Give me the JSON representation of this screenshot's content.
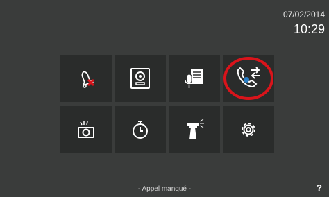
{
  "status": {
    "date": "07/02/2014",
    "time": "10:29"
  },
  "menu": {
    "items": [
      {
        "icon": "bell-muted-icon"
      },
      {
        "icon": "intercom-panel-icon"
      },
      {
        "icon": "voice-memo-icon"
      },
      {
        "icon": "call-transfer-icon"
      },
      {
        "icon": "camera-icon"
      },
      {
        "icon": "timer-icon"
      },
      {
        "icon": "cleaning-spray-icon"
      },
      {
        "icon": "settings-gear-icon"
      }
    ]
  },
  "footer": {
    "status_text": "- Appel manqué -",
    "help_label": "?"
  },
  "colors": {
    "background": "#3a3c3b",
    "tile": "#2a2c2b",
    "icon": "#ffffff",
    "alert": "#d9141b",
    "badge": "#2a7fc6"
  }
}
